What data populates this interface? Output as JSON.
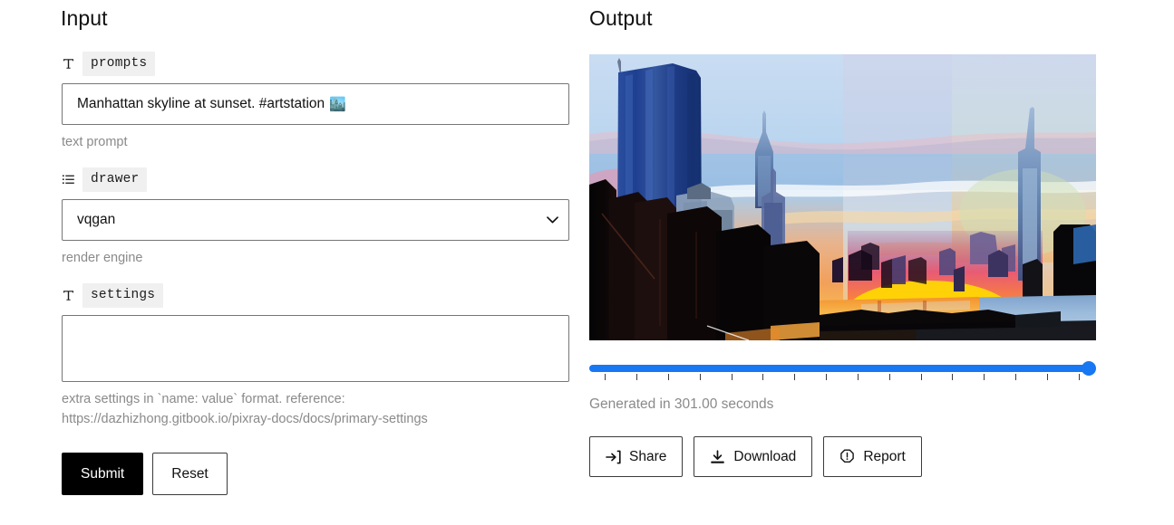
{
  "input": {
    "title": "Input",
    "fields": [
      {
        "icon": "text-icon",
        "label": "prompts",
        "value": "Manhattan skyline at sunset. #artstation",
        "emoji": "🏙️",
        "help": [
          "text prompt"
        ]
      },
      {
        "icon": "list-icon",
        "label": "drawer",
        "value": "vqgan",
        "options": [
          "vqgan"
        ],
        "help": [
          "render engine"
        ]
      },
      {
        "icon": "text-icon",
        "label": "settings",
        "value": "",
        "placeholder": "",
        "help": [
          "extra settings in `name: value` format. reference:",
          "https://dazhizhong.gitbook.io/pixray-docs/docs/primary-settings"
        ]
      }
    ],
    "submit_label": "Submit",
    "reset_label": "Reset"
  },
  "output": {
    "title": "Output",
    "image_alt": "Manhattan skyline at sunset generated artwork",
    "slider": {
      "value": 100,
      "min": 0,
      "max": 100,
      "tick_count": 16
    },
    "generated_text": "Generated in 301.00 seconds",
    "buttons": [
      {
        "icon": "share-icon",
        "label": "Share"
      },
      {
        "icon": "download-icon",
        "label": "Download"
      },
      {
        "icon": "report-icon",
        "label": "Report"
      }
    ]
  },
  "colors": {
    "accent_blue": "#1877f2",
    "chip_bg": "#f0f0f0",
    "border": "#767676",
    "help_text": "#8a8a8a",
    "primary_button_bg": "#000000"
  }
}
